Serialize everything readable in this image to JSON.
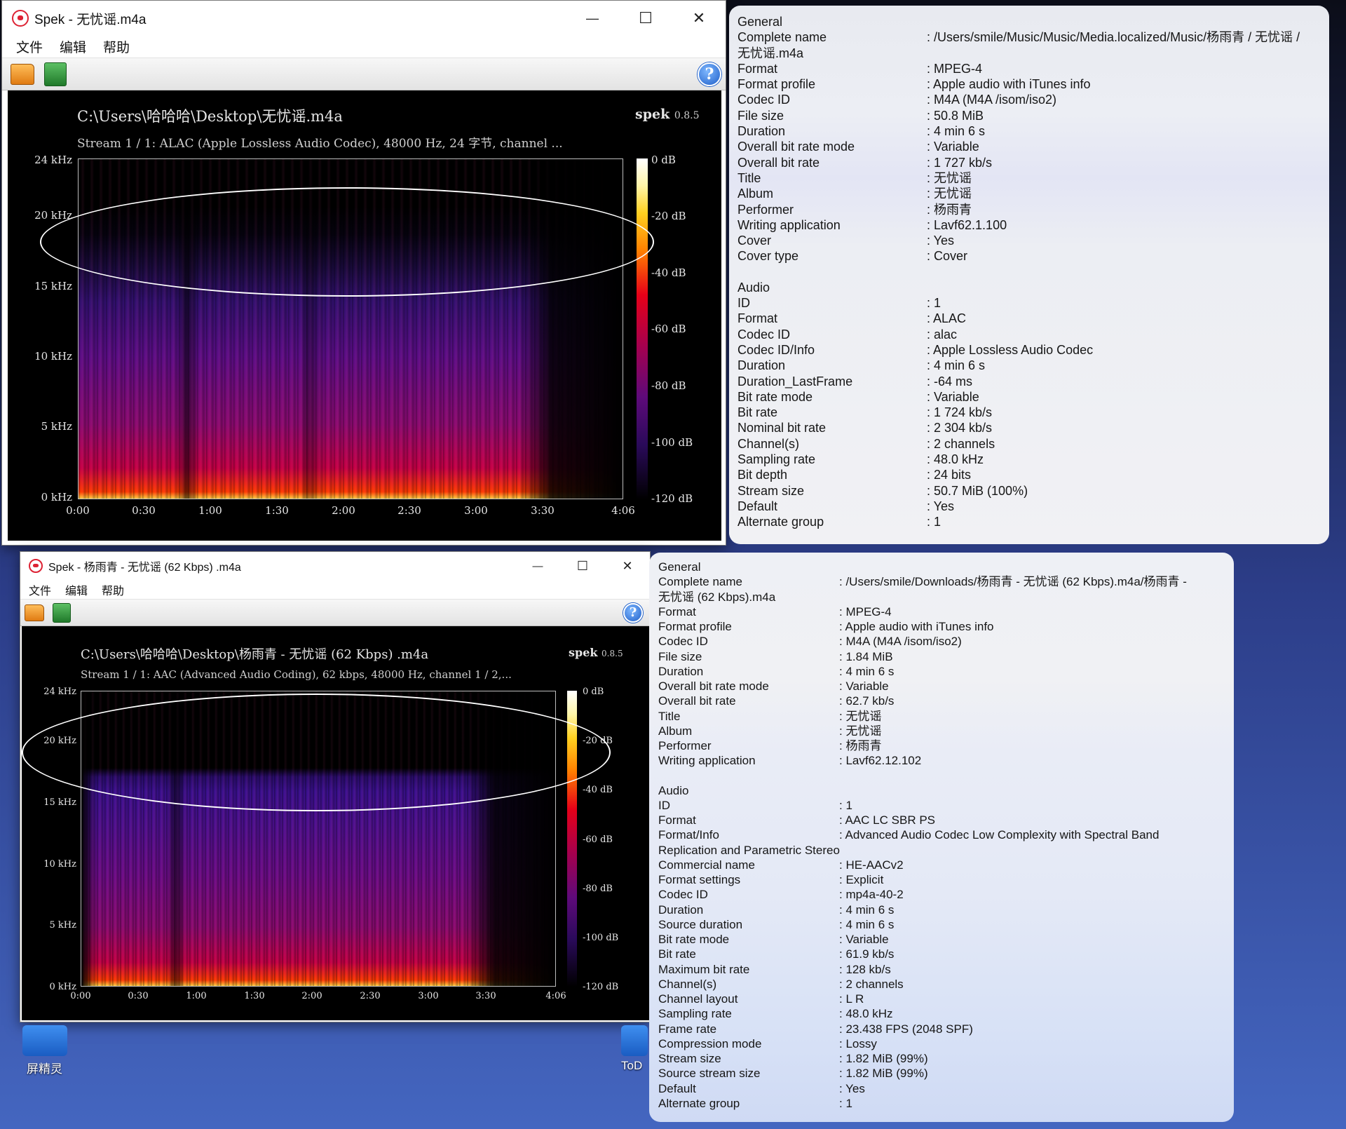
{
  "colors": {
    "window_bg": "#ffffff",
    "spectrogram_bg": "#000000",
    "ellipse": "#ffffff",
    "info_panel": "#eef0f6",
    "accent_blue": "#1f5fc8"
  },
  "icons": {
    "app": "spek-pig-icon",
    "open": "open-folder-icon",
    "save": "save-arrow-icon",
    "help": "help-question-icon",
    "minimize": "minimize-icon",
    "maximize": "maximize-icon",
    "close": "close-icon"
  },
  "window_top": {
    "title": "Spek - 无忧谣.m4a",
    "menu": [
      "文件",
      "编辑",
      "帮助"
    ],
    "controls": {
      "minimize": "—",
      "maximize": "☐",
      "close": "✕"
    },
    "help_glyph": "?",
    "spectrogram": {
      "path": "C:\\Users\\哈哈哈\\Desktop\\无忧谣.m4a",
      "stream": "Stream 1 / 1: ALAC (Apple Lossless Audio Codec), 48000 Hz, 24 字节, channel ...",
      "brand": "spek",
      "version": "0.8.5",
      "freq_ticks": [
        "24 kHz",
        "20 kHz",
        "15 kHz",
        "10 kHz",
        "5 kHz",
        "0 kHz"
      ],
      "time_ticks": [
        "0:00",
        "0:30",
        "1:00",
        "1:30",
        "2:00",
        "2:30",
        "3:00",
        "3:30",
        "4:06"
      ],
      "db_ticks": [
        "0 dB",
        "-20 dB",
        "-40 dB",
        "-60 dB",
        "-80 dB",
        "-100 dB",
        "-120 dB"
      ]
    }
  },
  "window_bottom": {
    "title": "Spek - 杨雨青 - 无忧谣 (62 Kbps) .m4a",
    "menu": [
      "文件",
      "编辑",
      "帮助"
    ],
    "controls": {
      "minimize": "—",
      "maximize": "☐",
      "close": "✕"
    },
    "help_glyph": "?",
    "spectrogram": {
      "path": "C:\\Users\\哈哈哈\\Desktop\\杨雨青 - 无忧谣 (62 Kbps) .m4a",
      "stream": "Stream 1 / 1: AAC (Advanced Audio Coding), 62 kbps, 48000 Hz, channel 1 / 2,...",
      "brand": "spek",
      "version": "0.8.5",
      "freq_ticks": [
        "24 kHz",
        "20 kHz",
        "15 kHz",
        "10 kHz",
        "5 kHz",
        "0 kHz"
      ],
      "time_ticks": [
        "0:00",
        "0:30",
        "1:00",
        "1:30",
        "2:00",
        "2:30",
        "3:00",
        "3:30",
        "4:06"
      ],
      "db_ticks": [
        "0 dB",
        "-20 dB",
        "-40 dB",
        "-60 dB",
        "-80 dB",
        "-100 dB",
        "-120 dB"
      ]
    }
  },
  "info_top": {
    "general_title": "General",
    "complete_name": {
      "k": "Complete name",
      "v": ": /Users/smile/Music/Music/Media.localized/Music/杨雨青 / 无忧谣 /",
      "cont": "无忧谣.m4a"
    },
    "general": [
      {
        "k": "Format",
        "v": ": MPEG-4"
      },
      {
        "k": "Format profile",
        "v": ": Apple audio with iTunes info"
      },
      {
        "k": "Codec ID",
        "v": ": M4A  (M4A /isom/iso2)"
      },
      {
        "k": "File size",
        "v": ": 50.8 MiB"
      },
      {
        "k": "Duration",
        "v": ": 4 min 6 s"
      },
      {
        "k": "Overall bit rate mode",
        "v": ": Variable"
      },
      {
        "k": "Overall bit rate",
        "v": ": 1 727 kb/s"
      },
      {
        "k": "Title",
        "v": ": 无忧谣"
      },
      {
        "k": "Album",
        "v": ": 无忧谣"
      },
      {
        "k": "Performer",
        "v": ": 杨雨青"
      },
      {
        "k": "Writing application",
        "v": ": Lavf62.1.100"
      },
      {
        "k": "Cover",
        "v": ": Yes"
      },
      {
        "k": "Cover type",
        "v": ": Cover"
      }
    ],
    "audio_title": "Audio",
    "audio": [
      {
        "k": "ID",
        "v": ": 1"
      },
      {
        "k": "Format",
        "v": ": ALAC"
      },
      {
        "k": "Codec ID",
        "v": ": alac"
      },
      {
        "k": "Codec ID/Info",
        "v": ": Apple Lossless Audio Codec"
      },
      {
        "k": "Duration",
        "v": ": 4 min 6 s"
      },
      {
        "k": "Duration_LastFrame",
        "v": ": -64 ms"
      },
      {
        "k": "Bit rate mode",
        "v": ": Variable"
      },
      {
        "k": "Bit rate",
        "v": ": 1 724 kb/s"
      },
      {
        "k": "Nominal bit rate",
        "v": ": 2 304 kb/s"
      },
      {
        "k": "Channel(s)",
        "v": ": 2 channels"
      },
      {
        "k": "Sampling rate",
        "v": ": 48.0 kHz"
      },
      {
        "k": "Bit depth",
        "v": ": 24 bits"
      },
      {
        "k": "Stream size",
        "v": ": 50.7 MiB (100%)"
      },
      {
        "k": "Default",
        "v": ": Yes"
      },
      {
        "k": "Alternate group",
        "v": ": 1"
      }
    ]
  },
  "info_bottom": {
    "general_title": "General",
    "complete_name": {
      "k": "Complete name",
      "v": ": /Users/smile/Downloads/杨雨青 - 无忧谣 (62 Kbps).m4a/杨雨青 -",
      "cont": "无忧谣 (62 Kbps).m4a"
    },
    "general": [
      {
        "k": "Format",
        "v": ": MPEG-4"
      },
      {
        "k": "Format profile",
        "v": ": Apple audio with iTunes info"
      },
      {
        "k": "Codec ID",
        "v": ": M4A  (M4A /isom/iso2)"
      },
      {
        "k": "File size",
        "v": ": 1.84 MiB"
      },
      {
        "k": "Duration",
        "v": ": 4 min 6 s"
      },
      {
        "k": "Overall bit rate mode",
        "v": ": Variable"
      },
      {
        "k": "Overall bit rate",
        "v": ": 62.7 kb/s"
      },
      {
        "k": "Title",
        "v": ": 无忧谣"
      },
      {
        "k": "Album",
        "v": ": 无忧谣"
      },
      {
        "k": "Performer",
        "v": ": 杨雨青"
      },
      {
        "k": "Writing application",
        "v": ": Lavf62.12.102"
      }
    ],
    "audio_title": "Audio",
    "audio_pre": [
      {
        "k": "ID",
        "v": ": 1"
      },
      {
        "k": "Format",
        "v": ": AAC LC SBR PS"
      },
      {
        "k": "Format/Info",
        "v": ": Advanced Audio Codec Low Complexity with Spectral Band"
      }
    ],
    "audio_wrap": "Replication and Parametric Stereo",
    "audio_post": [
      {
        "k": "Commercial name",
        "v": ": HE-AACv2"
      },
      {
        "k": "Format settings",
        "v": ": Explicit"
      },
      {
        "k": "Codec ID",
        "v": ": mp4a-40-2"
      },
      {
        "k": "Duration",
        "v": ": 4 min 6 s"
      },
      {
        "k": "Source duration",
        "v": ": 4 min 6 s"
      },
      {
        "k": "Bit rate mode",
        "v": ": Variable"
      },
      {
        "k": "Bit rate",
        "v": ": 61.9 kb/s"
      },
      {
        "k": "Maximum bit rate",
        "v": ": 128 kb/s"
      },
      {
        "k": "Channel(s)",
        "v": ": 2 channels"
      },
      {
        "k": "Channel layout",
        "v": ": L R"
      },
      {
        "k": "Sampling rate",
        "v": ": 48.0 kHz"
      },
      {
        "k": "Frame rate",
        "v": ": 23.438 FPS (2048 SPF)"
      },
      {
        "k": "Compression mode",
        "v": ": Lossy"
      },
      {
        "k": "Stream size",
        "v": ": 1.82 MiB (99%)"
      },
      {
        "k": "Source stream size",
        "v": ": 1.82 MiB (99%)"
      },
      {
        "k": "Default",
        "v": ": Yes"
      },
      {
        "k": "Alternate group",
        "v": ": 1"
      }
    ]
  },
  "desktop": {
    "icon1_label": "屏精灵",
    "icon2_label": "ToD"
  }
}
